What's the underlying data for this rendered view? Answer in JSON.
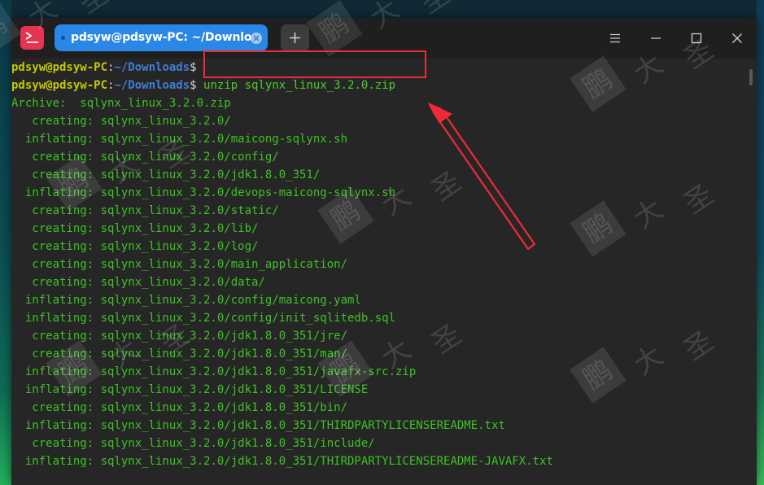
{
  "window": {
    "tab_title": "pdsyw@pdsyw-PC: ~/Downloads"
  },
  "icons": {
    "app": "terminal-app-icon",
    "tab_close": "close-circle-icon",
    "new_tab": "plus-icon",
    "menu": "hamburger-menu-icon",
    "minimize": "minimize-icon",
    "maximize": "maximize-icon",
    "close": "close-icon"
  },
  "colors": {
    "tab_active": "#2a87e6",
    "prompt_user": "#c3c800",
    "prompt_path": "#3f7fd4",
    "output": "#3cc323",
    "highlight_box": "#f02b3a",
    "annotation_arrow": "#ee2a36"
  },
  "terminal": {
    "prompt1": {
      "user": "pdsyw@pdsyw-PC",
      "colon": ":",
      "path": "~/Downloads",
      "symbol": "$",
      "command": ""
    },
    "prompt2": {
      "user": "pdsyw@pdsyw-PC",
      "colon": ":",
      "path": "~/Downloads",
      "symbol": "$",
      "command": " unzip sqlynx_linux_3.2.0.zip"
    },
    "output": [
      "Archive:  sqlynx_linux_3.2.0.zip",
      "   creating: sqlynx_linux_3.2.0/",
      "  inflating: sqlynx_linux_3.2.0/maicong-sqlynx.sh",
      "   creating: sqlynx_linux_3.2.0/config/",
      "   creating: sqlynx_linux_3.2.0/jdk1.8.0_351/",
      "  inflating: sqlynx_linux_3.2.0/devops-maicong-sqlynx.sh",
      "   creating: sqlynx_linux_3.2.0/static/",
      "   creating: sqlynx_linux_3.2.0/lib/",
      "   creating: sqlynx_linux_3.2.0/log/",
      "   creating: sqlynx_linux_3.2.0/main_application/",
      "   creating: sqlynx_linux_3.2.0/data/",
      "  inflating: sqlynx_linux_3.2.0/config/maicong.yaml",
      "  inflating: sqlynx_linux_3.2.0/config/init_sqlitedb.sql",
      "   creating: sqlynx_linux_3.2.0/jdk1.8.0_351/jre/",
      "   creating: sqlynx_linux_3.2.0/jdk1.8.0_351/man/",
      "  inflating: sqlynx_linux_3.2.0/jdk1.8.0_351/javafx-src.zip",
      "  inflating: sqlynx_linux_3.2.0/jdk1.8.0_351/LICENSE",
      "   creating: sqlynx_linux_3.2.0/jdk1.8.0_351/bin/",
      "  inflating: sqlynx_linux_3.2.0/jdk1.8.0_351/THIRDPARTYLICENSEREADME.txt",
      "   creating: sqlynx_linux_3.2.0/jdk1.8.0_351/include/",
      "  inflating: sqlynx_linux_3.2.0/jdk1.8.0_351/THIRDPARTYLICENSEREADME-JAVAFX.txt"
    ]
  },
  "watermark": {
    "chars": [
      "鹏",
      "大",
      "圣"
    ]
  }
}
